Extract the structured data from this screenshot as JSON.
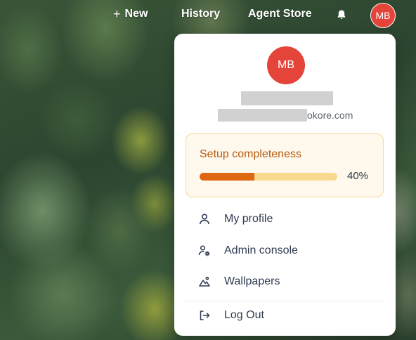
{
  "header": {
    "new_label": "New",
    "history_label": "History",
    "agent_store_label": "Agent Store",
    "avatar_initials": "MB"
  },
  "profile_menu": {
    "avatar_initials": "MB",
    "email_suffix": "okore.com",
    "setup": {
      "title": "Setup completeness",
      "progress_percent": 40,
      "progress_label": "40%"
    },
    "items": [
      {
        "label": "My profile",
        "icon": "user-icon"
      },
      {
        "label": "Admin console",
        "icon": "admin-settings-icon"
      },
      {
        "label": "Wallpapers",
        "icon": "image-icon"
      },
      {
        "label": "Log Out",
        "icon": "logout-icon"
      }
    ]
  },
  "colors": {
    "avatar_red": "#e5443a",
    "progress_fill": "#dd6810",
    "progress_track": "#f7d98f",
    "setup_title": "#b85a0e"
  }
}
